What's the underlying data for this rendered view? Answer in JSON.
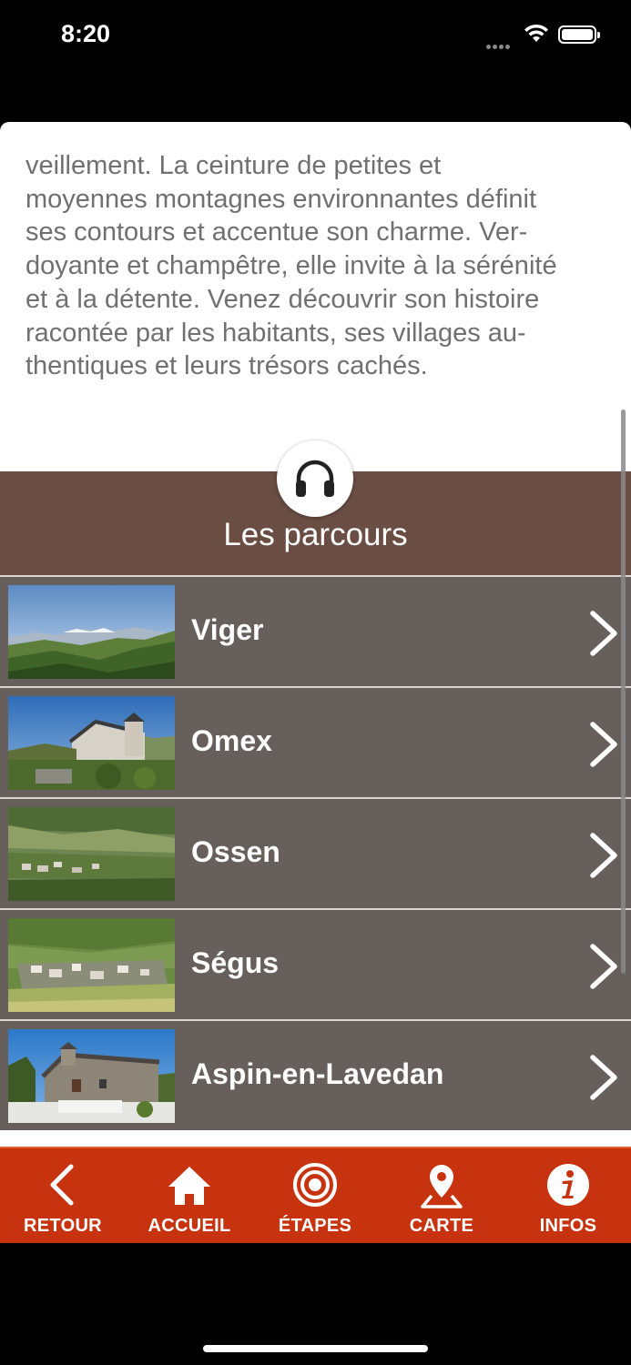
{
  "status_bar": {
    "time": "8:20"
  },
  "intro": {
    "lines": [
      "veillement. La ceinture de petites et",
      "moyennes montagnes environnantes définit",
      "ses contours et accentue son charme. Ver-",
      "doyante et champêtre, elle invite à la sérénité",
      "et à la détente. Venez découvrir son histoire",
      "racontée par les habitants, ses villages au-",
      "thentiques et leurs trésors cachés."
    ]
  },
  "section": {
    "title": "Les parcours",
    "audio_icon": "headphones-icon"
  },
  "routes": [
    {
      "name": "Viger"
    },
    {
      "name": "Omex"
    },
    {
      "name": "Ossen"
    },
    {
      "name": "Ségus"
    },
    {
      "name": "Aspin-en-Lavedan"
    }
  ],
  "nav": {
    "back": {
      "label": "RETOUR",
      "icon": "chevron-left-icon"
    },
    "home": {
      "label": "ACCUEIL",
      "icon": "home-icon"
    },
    "stages": {
      "label": "ÉTAPES",
      "icon": "target-icon"
    },
    "map": {
      "label": "CARTE",
      "icon": "map-pin-icon"
    },
    "info": {
      "label": "INFOS",
      "icon": "info-icon"
    }
  },
  "colors": {
    "header_brown": "#6a4e44",
    "row_gray": "#675f5c",
    "nav_red": "#c8330f",
    "text_gray": "#707070"
  }
}
